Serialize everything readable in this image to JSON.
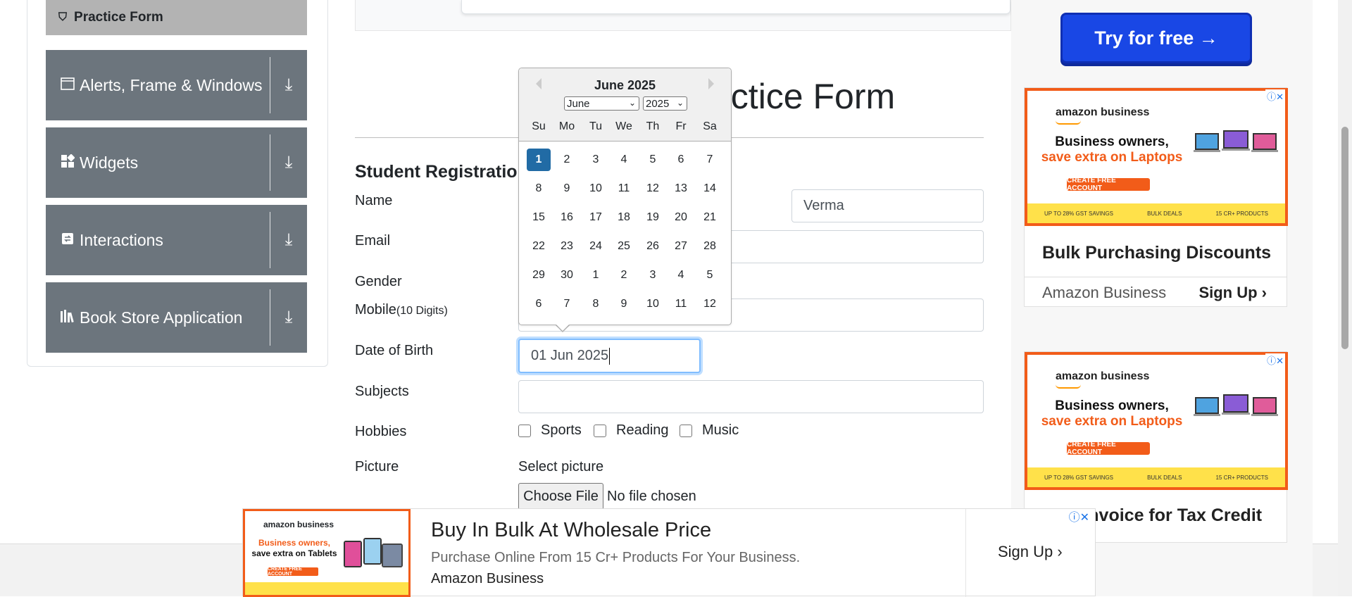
{
  "sidebar": {
    "active_item": "Practice Form",
    "groups": [
      {
        "label": "Alerts, Frame & Windows",
        "icon": "window-icon"
      },
      {
        "label": "Widgets",
        "icon": "widgets-icon"
      },
      {
        "label": "Interactions",
        "icon": "interactions-icon"
      },
      {
        "label": "Book Store Application",
        "icon": "books-icon"
      }
    ]
  },
  "form": {
    "title": "Practice Form",
    "section_heading": "Student Registration Form",
    "labels": {
      "name": "Name",
      "email": "Email",
      "gender": "Gender",
      "mobile": "Mobile",
      "mobile_hint": "(10 Digits)",
      "dob": "Date of Birth",
      "subjects": "Subjects",
      "hobbies": "Hobbies",
      "picture": "Picture"
    },
    "last_name_value": "Verma",
    "dob_value": "01 Jun 2025",
    "hobbies": [
      "Sports",
      "Reading",
      "Music"
    ],
    "picture_prompt": "Select picture",
    "file_button": "Choose File",
    "file_status": "No file chosen"
  },
  "datepicker": {
    "header": "June 2025",
    "month_select": "June",
    "year_select": "2025",
    "day_names": [
      "Su",
      "Mo",
      "Tu",
      "We",
      "Th",
      "Fr",
      "Sa"
    ],
    "weeks": [
      [
        "1",
        "2",
        "3",
        "4",
        "5",
        "6",
        "7"
      ],
      [
        "8",
        "9",
        "10",
        "11",
        "12",
        "13",
        "14"
      ],
      [
        "15",
        "16",
        "17",
        "18",
        "19",
        "20",
        "21"
      ],
      [
        "22",
        "23",
        "24",
        "25",
        "26",
        "27",
        "28"
      ],
      [
        "29",
        "30",
        "1",
        "2",
        "3",
        "4",
        "5"
      ],
      [
        "6",
        "7",
        "8",
        "9",
        "10",
        "11",
        "12"
      ]
    ],
    "selected_day": "1"
  },
  "ads": {
    "try_button": "Try for free →",
    "card1": {
      "brand_logo": "amazon business",
      "headline_1": "Business owners,",
      "headline_2": "save extra on Laptops",
      "cta": "CREATE FREE ACCOUNT",
      "title": "Bulk Purchasing Discounts",
      "advertiser": "Amazon Business",
      "signup": "Sign Up"
    },
    "card2": {
      "brand_logo": "amazon business",
      "headline_1": "Business owners,",
      "headline_2": "save extra on Laptops",
      "cta": "CREATE FREE ACCOUNT",
      "title": "GST Invoice for Tax Credit"
    },
    "strip": [
      "UP TO 28% GST SAVINGS",
      "BULK DEALS",
      "15 CR+ PRODUCTS"
    ],
    "bottom": {
      "brand_logo": "amazon business",
      "headline_1": "Business owners,",
      "headline_2": "save extra on Tablets",
      "cta": "CREATE FREE ACCOUNT",
      "title": "Buy In Bulk At Wholesale Price",
      "description": "Purchase Online From 15 Cr+ Products For Your Business.",
      "advertiser": "Amazon Business",
      "signup": "Sign Up"
    }
  },
  "colors": {
    "sidebar_group": "#6c757d",
    "sidebar_active": "#b3b3b3",
    "selected_day": "#216ba5",
    "ad_orange": "#f25c19",
    "try_blue": "#1947e5"
  }
}
